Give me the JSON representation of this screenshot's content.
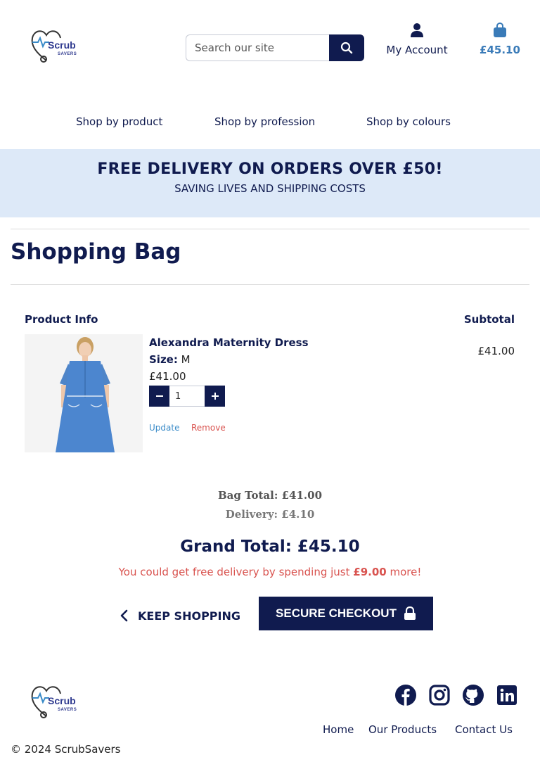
{
  "header": {
    "logo": {
      "name": "Scrub",
      "sub": "SAVERS"
    },
    "search": {
      "placeholder": "Search our site"
    },
    "account_label": "My Account",
    "bag_amount": "£45.10"
  },
  "nav": {
    "items": [
      "Shop by product",
      "Shop by profession",
      "Shop by colours"
    ]
  },
  "banner": {
    "title": "FREE DELIVERY ON ORDERS OVER £50!",
    "subtitle": "SAVING LIVES AND SHIPPING COSTS"
  },
  "page_title": "Shopping Bag",
  "table": {
    "col_product": "Product Info",
    "col_subtotal": "Subtotal"
  },
  "item": {
    "name": "Alexandra Maternity Dress",
    "size_label": "Size:",
    "size_value": "M",
    "price": "£41.00",
    "quantity": "1",
    "update_label": "Update",
    "remove_label": "Remove",
    "subtotal": "£41.00"
  },
  "totals": {
    "bag_total": "Bag Total: £41.00",
    "delivery": "Delivery: £4.10",
    "grand_total": "Grand Total: £45.10",
    "free_msg_prefix": "You could get free delivery by spending just ",
    "free_msg_amount": "£9.00",
    "free_msg_suffix": " more!"
  },
  "actions": {
    "keep_shopping": "KEEP SHOPPING",
    "checkout": "SECURE CHECKOUT"
  },
  "footer": {
    "logo": {
      "name": "Scrub",
      "sub": "SAVERS"
    },
    "social": [
      "facebook-icon",
      "instagram-icon",
      "github-icon",
      "linkedin-icon"
    ],
    "links": [
      "Home",
      "Our Products",
      "Contact Us"
    ],
    "copyright": "© 2024 ScrubSavers"
  },
  "colors": {
    "navy": "#101b4f",
    "banner_bg": "#dde9f8",
    "accent_blue": "#3a7bb8",
    "alert_red": "#d9534f"
  }
}
